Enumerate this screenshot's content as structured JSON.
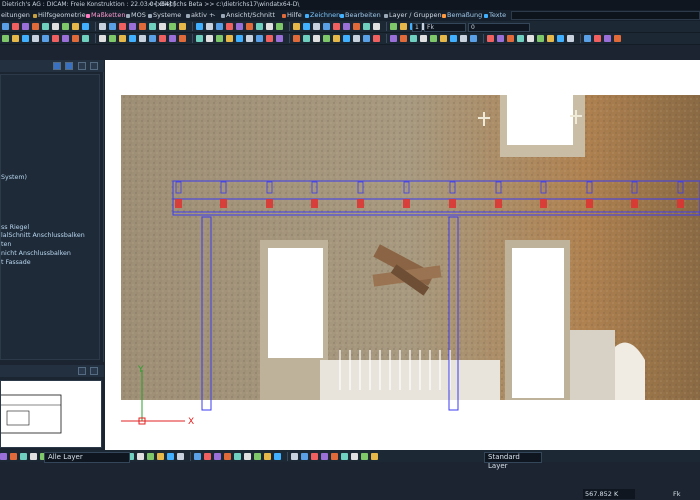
{
  "window": {
    "title": "Dietrich's AG : DICAM: Freie Konstruktion : 22.03.0 [x64] ]",
    "beta_path": "<< Dietrichs Beta >> c:\\dietrichs17\\windatx64-D\\"
  },
  "menu": {
    "items": [
      "eitungen",
      "Hilfsgeometrie",
      "Maßketten",
      "MOS",
      "Systeme",
      "aktiv +",
      "-",
      "Ansicht/Schnitt",
      "Hilfe",
      "Zeichnen",
      "Bearbeiten",
      "Layer / Gruppen",
      "Bemaßung",
      "Texte"
    ]
  },
  "toolbar1": {
    "field_value": "1",
    "field_fk": "Fk",
    "field_zero": "0"
  },
  "left_panel": {
    "tree": [
      "System)",
      "ss Riegel",
      "lalSchnitt Anschlussbalken",
      "ten",
      "nicht Anschlussbalken",
      "t Fassade"
    ]
  },
  "canvas": {
    "axis_y_label": "Y",
    "axis_x_label": "X"
  },
  "status": {
    "layer_left": "Alle Layer",
    "layer_right": "Standard Layer",
    "coord": "567.852 K",
    "fk": "Fk"
  },
  "colors": {
    "ui_dark": "#1b2430",
    "menu_highlight": "#7ec8ff",
    "pointcloud_stone": "#a8967a",
    "pointcloud_dark": "#6e5e48",
    "pointcloud_warm": "#b07a44",
    "construction_blue": "#3d3df0",
    "marker_red": "#e03030",
    "axis_green": "#2ea02e",
    "axis_red": "#e02020"
  }
}
